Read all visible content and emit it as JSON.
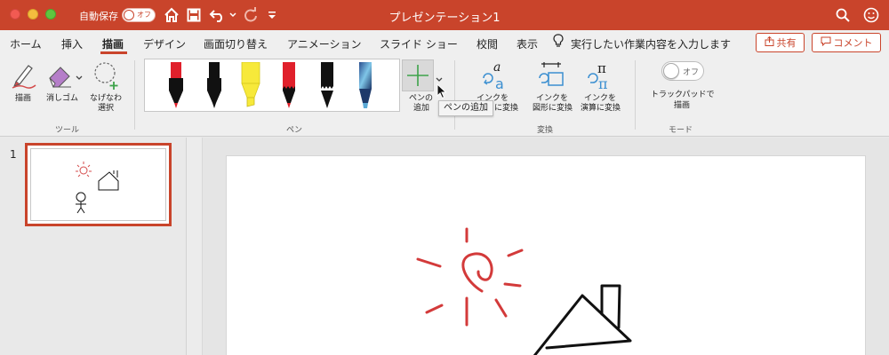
{
  "titlebar": {
    "autosave_label": "自動保存",
    "autosave_state": "オフ",
    "document_title": "プレゼンテーション1",
    "accent": "#c9442b"
  },
  "tabs": [
    {
      "label": "ホーム"
    },
    {
      "label": "挿入"
    },
    {
      "label": "描画",
      "active": true
    },
    {
      "label": "デザイン"
    },
    {
      "label": "画面切り替え"
    },
    {
      "label": "アニメーション"
    },
    {
      "label": "スライド ショー"
    },
    {
      "label": "校閲"
    },
    {
      "label": "表示"
    }
  ],
  "tell_me": "実行したい作業内容を入力します",
  "share_label": "共有",
  "comment_label": "コメント",
  "ribbon": {
    "tools": {
      "draw": "描画",
      "eraser": "消しゴム",
      "lasso_line1": "なげなわ",
      "lasso_line2": "選択",
      "group_label": "ツール"
    },
    "pens": {
      "group_label": "ペン",
      "add_pen_line1": "ペンの",
      "add_pen_line2": "追加",
      "tooltip": "ペンの追加",
      "colors": [
        "#e0202b",
        "#111111",
        "#f7e93a",
        "#e0202b",
        "#111111",
        "#5aa9d6"
      ]
    },
    "convert": {
      "group_label": "変換",
      "to_text_line1": "インクを",
      "to_text_line2": "に変換",
      "to_shape_line1": "インクを",
      "to_shape_line2": "図形に変換",
      "to_math_line1": "インクを",
      "to_math_line2": "演算に変換"
    },
    "mode": {
      "group_label": "モード",
      "toggle_state": "オフ",
      "label_line1": "トラックパッドで",
      "label_line2": "描画"
    }
  },
  "slides_panel": {
    "slide_number": "1"
  }
}
